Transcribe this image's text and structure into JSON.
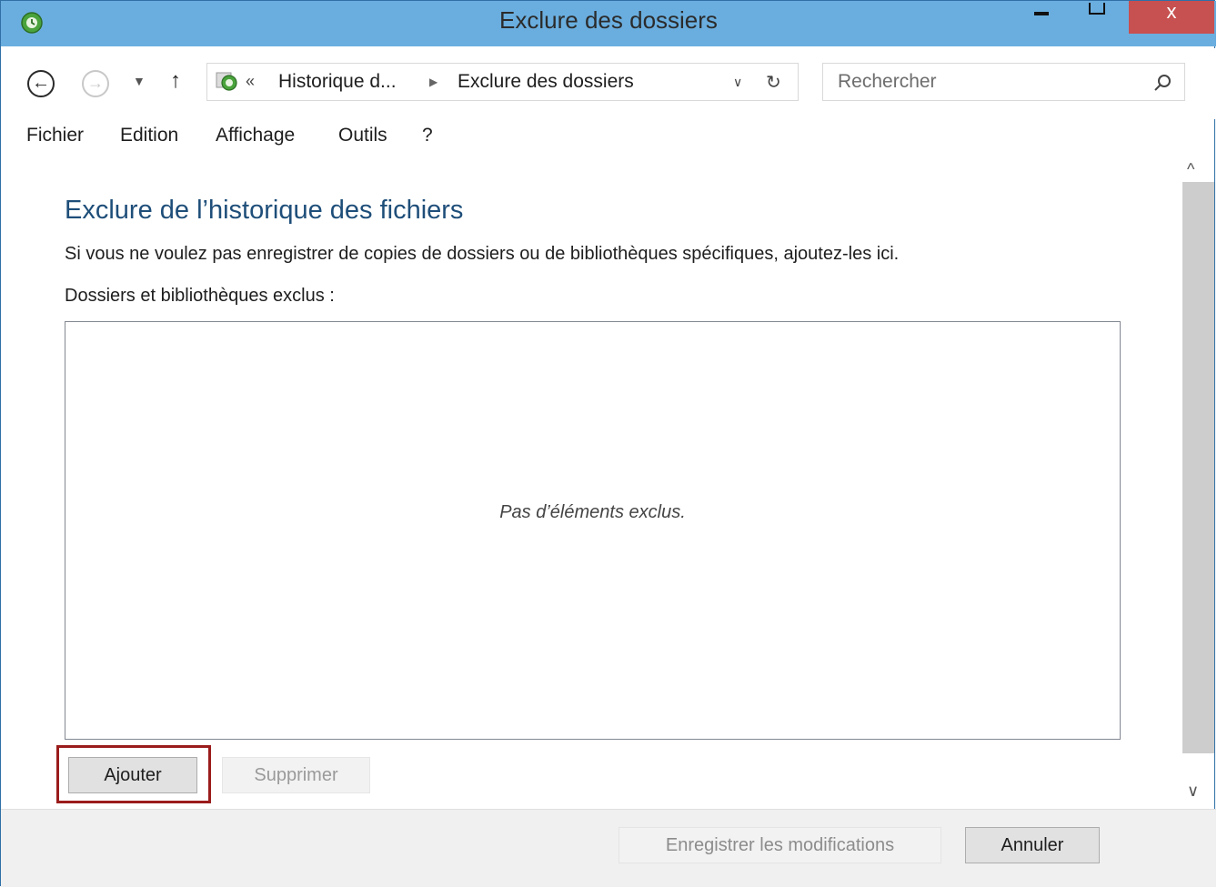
{
  "window": {
    "title": "Exclure des dossiers",
    "controls": {
      "minimize": "minimize",
      "maximize": "maximize",
      "close": "x"
    }
  },
  "navigation": {
    "back_icon": "back-arrow-icon",
    "forward_icon": "forward-arrow-icon",
    "recent_icon": "chevron-down-icon",
    "up_icon": "up-arrow-icon",
    "address": {
      "prefix": "«",
      "segments": [
        "Historique d...",
        "Exclure des dossiers"
      ]
    },
    "search_placeholder": "Rechercher"
  },
  "menu": {
    "items": [
      "Fichier",
      "Edition",
      "Affichage",
      "Outils",
      "?"
    ]
  },
  "content": {
    "heading": "Exclure de l’historique des fichiers",
    "description": "Si vous ne voulez pas enregistrer de copies de dossiers ou de bibliothèques spécifiques, ajoutez-les ici.",
    "list_label": "Dossiers et bibliothèques exclus :",
    "empty_message": "Pas d’éléments exclus."
  },
  "buttons": {
    "add": "Ajouter",
    "remove": "Supprimer",
    "save": "Enregistrer les modifications",
    "cancel": "Annuler"
  },
  "colors": {
    "titlebar": "#6aaedf",
    "close": "#c75050",
    "heading": "#1e4e79",
    "highlight": "#9b1c1c"
  }
}
